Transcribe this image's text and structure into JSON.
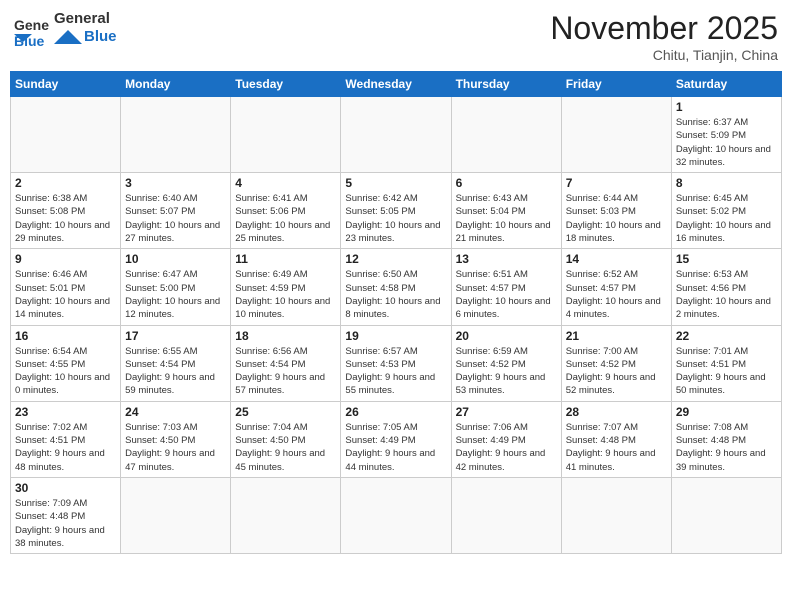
{
  "header": {
    "logo_general": "General",
    "logo_blue": "Blue",
    "month_title": "November 2025",
    "location": "Chitu, Tianjin, China"
  },
  "weekdays": [
    "Sunday",
    "Monday",
    "Tuesday",
    "Wednesday",
    "Thursday",
    "Friday",
    "Saturday"
  ],
  "days": {
    "1": {
      "sunrise": "6:37 AM",
      "sunset": "5:09 PM",
      "daylight": "10 hours and 32 minutes."
    },
    "2": {
      "sunrise": "6:38 AM",
      "sunset": "5:08 PM",
      "daylight": "10 hours and 29 minutes."
    },
    "3": {
      "sunrise": "6:40 AM",
      "sunset": "5:07 PM",
      "daylight": "10 hours and 27 minutes."
    },
    "4": {
      "sunrise": "6:41 AM",
      "sunset": "5:06 PM",
      "daylight": "10 hours and 25 minutes."
    },
    "5": {
      "sunrise": "6:42 AM",
      "sunset": "5:05 PM",
      "daylight": "10 hours and 23 minutes."
    },
    "6": {
      "sunrise": "6:43 AM",
      "sunset": "5:04 PM",
      "daylight": "10 hours and 21 minutes."
    },
    "7": {
      "sunrise": "6:44 AM",
      "sunset": "5:03 PM",
      "daylight": "10 hours and 18 minutes."
    },
    "8": {
      "sunrise": "6:45 AM",
      "sunset": "5:02 PM",
      "daylight": "10 hours and 16 minutes."
    },
    "9": {
      "sunrise": "6:46 AM",
      "sunset": "5:01 PM",
      "daylight": "10 hours and 14 minutes."
    },
    "10": {
      "sunrise": "6:47 AM",
      "sunset": "5:00 PM",
      "daylight": "10 hours and 12 minutes."
    },
    "11": {
      "sunrise": "6:49 AM",
      "sunset": "4:59 PM",
      "daylight": "10 hours and 10 minutes."
    },
    "12": {
      "sunrise": "6:50 AM",
      "sunset": "4:58 PM",
      "daylight": "10 hours and 8 minutes."
    },
    "13": {
      "sunrise": "6:51 AM",
      "sunset": "4:57 PM",
      "daylight": "10 hours and 6 minutes."
    },
    "14": {
      "sunrise": "6:52 AM",
      "sunset": "4:57 PM",
      "daylight": "10 hours and 4 minutes."
    },
    "15": {
      "sunrise": "6:53 AM",
      "sunset": "4:56 PM",
      "daylight": "10 hours and 2 minutes."
    },
    "16": {
      "sunrise": "6:54 AM",
      "sunset": "4:55 PM",
      "daylight": "10 hours and 0 minutes."
    },
    "17": {
      "sunrise": "6:55 AM",
      "sunset": "4:54 PM",
      "daylight": "9 hours and 59 minutes."
    },
    "18": {
      "sunrise": "6:56 AM",
      "sunset": "4:54 PM",
      "daylight": "9 hours and 57 minutes."
    },
    "19": {
      "sunrise": "6:57 AM",
      "sunset": "4:53 PM",
      "daylight": "9 hours and 55 minutes."
    },
    "20": {
      "sunrise": "6:59 AM",
      "sunset": "4:52 PM",
      "daylight": "9 hours and 53 minutes."
    },
    "21": {
      "sunrise": "7:00 AM",
      "sunset": "4:52 PM",
      "daylight": "9 hours and 52 minutes."
    },
    "22": {
      "sunrise": "7:01 AM",
      "sunset": "4:51 PM",
      "daylight": "9 hours and 50 minutes."
    },
    "23": {
      "sunrise": "7:02 AM",
      "sunset": "4:51 PM",
      "daylight": "9 hours and 48 minutes."
    },
    "24": {
      "sunrise": "7:03 AM",
      "sunset": "4:50 PM",
      "daylight": "9 hours and 47 minutes."
    },
    "25": {
      "sunrise": "7:04 AM",
      "sunset": "4:50 PM",
      "daylight": "9 hours and 45 minutes."
    },
    "26": {
      "sunrise": "7:05 AM",
      "sunset": "4:49 PM",
      "daylight": "9 hours and 44 minutes."
    },
    "27": {
      "sunrise": "7:06 AM",
      "sunset": "4:49 PM",
      "daylight": "9 hours and 42 minutes."
    },
    "28": {
      "sunrise": "7:07 AM",
      "sunset": "4:48 PM",
      "daylight": "9 hours and 41 minutes."
    },
    "29": {
      "sunrise": "7:08 AM",
      "sunset": "4:48 PM",
      "daylight": "9 hours and 39 minutes."
    },
    "30": {
      "sunrise": "7:09 AM",
      "sunset": "4:48 PM",
      "daylight": "9 hours and 38 minutes."
    }
  },
  "labels": {
    "sunrise": "Sunrise:",
    "sunset": "Sunset:",
    "daylight": "Daylight:"
  }
}
